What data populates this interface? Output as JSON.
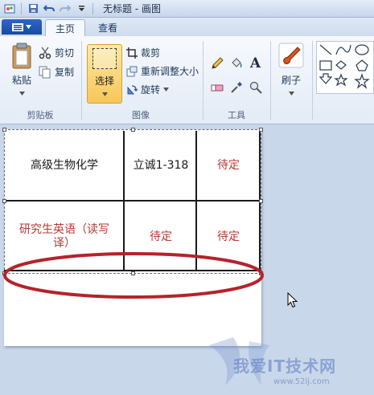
{
  "window": {
    "title": "无标题 - 画图"
  },
  "tabs": [
    {
      "label": "主页",
      "active": true
    },
    {
      "label": "查看",
      "active": false
    }
  ],
  "ribbon": {
    "clipboard": {
      "group_label": "剪贴板",
      "paste": "粘贴",
      "cut": "剪切",
      "copy": "复制"
    },
    "image": {
      "group_label": "图像",
      "select": "选择",
      "crop": "裁剪",
      "resize": "重新调整大小",
      "rotate": "旋转"
    },
    "tools": {
      "group_label": "工具",
      "text_glyph": "A"
    },
    "brushes": {
      "label": "刷子"
    }
  },
  "table": {
    "rows": [
      [
        "高级生物化学",
        "立诚1-318",
        "待定"
      ],
      [
        "研究生英语（读写译）",
        "待定",
        "待定"
      ]
    ]
  },
  "watermark": {
    "brand": "我爱IT技术网",
    "url": "www.52ij.com"
  },
  "colors": {
    "accent_red": "#b33a33",
    "ellipse_red": "#b5232b",
    "select_yellow": "#f7c659"
  }
}
